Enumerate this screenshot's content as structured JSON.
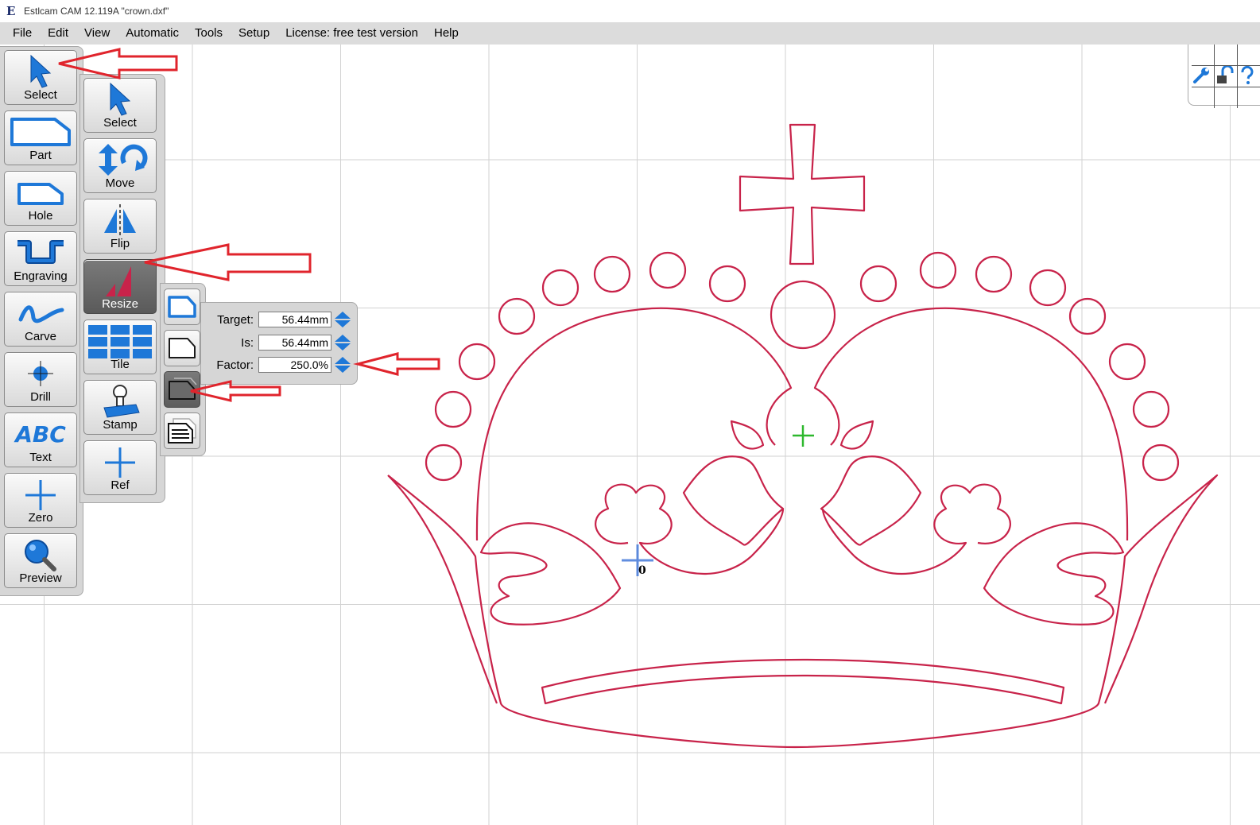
{
  "window": {
    "title": "Estlcam CAM 12.119A \"crown.dxf\""
  },
  "menu": [
    "File",
    "Edit",
    "View",
    "Automatic",
    "Tools",
    "Setup",
    "License: free test version",
    "Help"
  ],
  "toolbar": {
    "select": "Select",
    "part": "Part",
    "hole": "Hole",
    "engraving": "Engraving",
    "carve": "Carve",
    "drill": "Drill",
    "text": "Text",
    "zero": "Zero",
    "preview": "Preview"
  },
  "subtoolbar": {
    "select": "Select",
    "move": "Move",
    "flip": "Flip",
    "resize": "Resize",
    "tile": "Tile",
    "stamp": "Stamp",
    "ref": "Ref"
  },
  "text_icon_glyph": "ABC",
  "resize": {
    "target_label": "Target:",
    "target_value": "56.44mm",
    "is_label": "Is:",
    "is_value": "56.44mm",
    "factor_label": "Factor:",
    "factor_value": "250.0%"
  },
  "canvas": {
    "origin_label": "0"
  },
  "colors": {
    "outline": "#c8234a",
    "accent": "#1e78d8",
    "center_marker": "#2eb82e",
    "annotation_arrow": "#e0242c",
    "panel": "#d6d6d6",
    "grid": "#d2d2d2"
  },
  "icons": [
    "select-arrow-icon",
    "part-icon",
    "hole-icon",
    "engraving-icon",
    "carve-icon",
    "drill-icon",
    "text-icon",
    "zero-icon",
    "magnifier-icon",
    "move-icon",
    "flip-icon",
    "resize-icon",
    "tile-icon",
    "stamp-icon",
    "ref-icon",
    "wrench-icon",
    "lock-icon",
    "help-icon"
  ]
}
